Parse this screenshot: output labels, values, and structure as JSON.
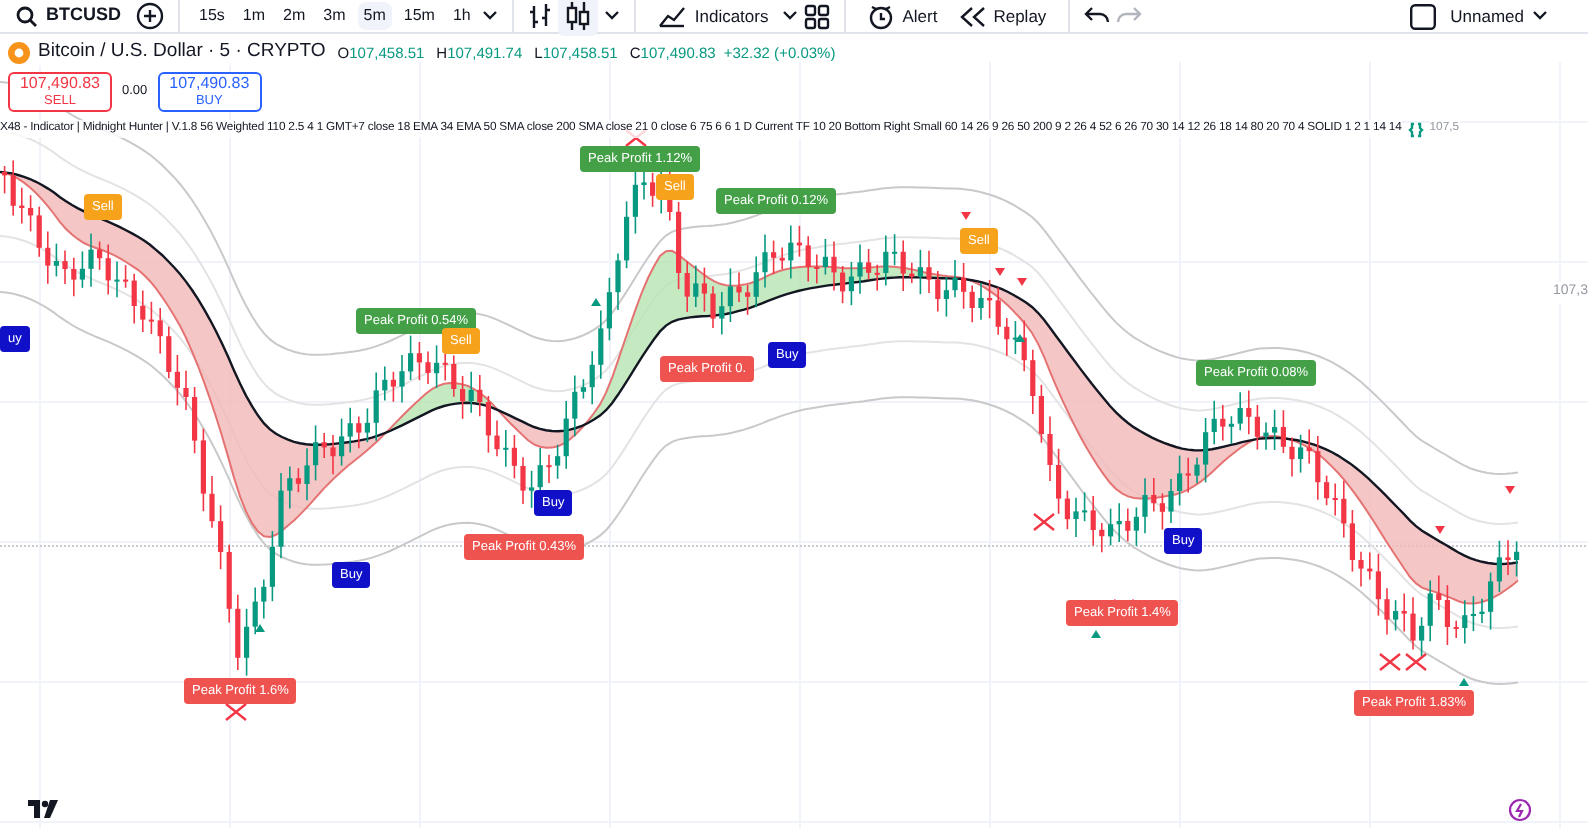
{
  "toolbar": {
    "symbol": "BTCUSD",
    "intervals": [
      {
        "label": "15s",
        "selected": false
      },
      {
        "label": "1m",
        "selected": false
      },
      {
        "label": "2m",
        "selected": false
      },
      {
        "label": "3m",
        "selected": false
      },
      {
        "label": "5m",
        "selected": true
      },
      {
        "label": "15m",
        "selected": false
      },
      {
        "label": "1h",
        "selected": false
      }
    ],
    "indicators": "Indicators",
    "alert": "Alert",
    "replay": "Replay",
    "layout_name": "Unnamed"
  },
  "legend": {
    "title": "Bitcoin / U.S. Dollar · 5 · CRYPTO",
    "ohlc": [
      {
        "key": "O",
        "value": "107,458.51"
      },
      {
        "key": "H",
        "value": "107,491.74"
      },
      {
        "key": "L",
        "value": "107,458.51"
      },
      {
        "key": "C",
        "value": "107,490.83"
      }
    ],
    "change": "+32.32 (+0.03%)",
    "sell": {
      "price": "107,490.83",
      "label": "SELL"
    },
    "spread": "0.00",
    "buy": {
      "price": "107,490.83",
      "label": "BUY"
    },
    "indicator": "X48 - Indicator | Midnight Hunter | V.1.8 56 Weighted 110 2.5 4 1 GMT+7 close 18 EMA 34 EMA 50 SMA close 200 SMA close 21 0 close 6 75 6 6 1 D Current TF 10 20 Bottom Right Small 60 14 26 9 26 50 200 9 2 26 4 52 6 26 70 30 14 12 26 18 14 80 20 70 4 SOLID 1 2 1 14 14",
    "indicator_value": "107,5"
  },
  "signals": [
    {
      "kind": "sell",
      "text": "Sell"
    },
    {
      "kind": "profit_up",
      "text": "Peak Profit 1.12%"
    },
    {
      "kind": "sell",
      "text": "Sell"
    },
    {
      "kind": "profit_up",
      "text": "Peak Profit 0.12%"
    },
    {
      "kind": "sell",
      "text": "Sell"
    },
    {
      "kind": "buy",
      "text": "uy"
    },
    {
      "kind": "profit_up",
      "text": "Peak Profit 0.54%"
    },
    {
      "kind": "sell",
      "text": "Sell"
    },
    {
      "kind": "profit_down",
      "text": "Peak Profit 0."
    },
    {
      "kind": "buy",
      "text": "Buy"
    },
    {
      "kind": "profit_up",
      "text": "Peak Profit 0.08%"
    },
    {
      "kind": "buy",
      "text": "Buy"
    },
    {
      "kind": "profit_down",
      "text": "Peak Profit 0.43%"
    },
    {
      "kind": "buy",
      "text": "Buy"
    },
    {
      "kind": "buy",
      "text": "Buy"
    },
    {
      "kind": "profit_down",
      "text": "Peak Profit 1.4%"
    },
    {
      "kind": "profit_down",
      "text": "Peak Profit 1.6%"
    },
    {
      "kind": "profit_down",
      "text": "Peak Profit 1.83%"
    }
  ],
  "price_scale_label": "107,3"
}
